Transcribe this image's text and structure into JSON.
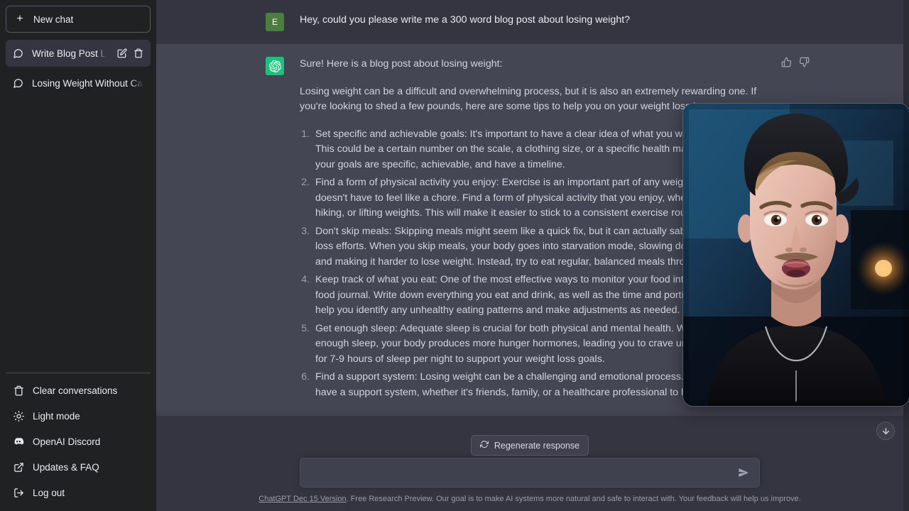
{
  "sidebar": {
    "new_chat_label": "New chat",
    "chats": [
      {
        "title": "Write Blog Post Losing",
        "active": true
      },
      {
        "title": "Losing Weight Without Calorie",
        "active": false
      }
    ],
    "bottom_items": [
      {
        "label": "Clear conversations",
        "icon": "trash-icon"
      },
      {
        "label": "Light mode",
        "icon": "sun-icon"
      },
      {
        "label": "OpenAI Discord",
        "icon": "discord-icon"
      },
      {
        "label": "Updates & FAQ",
        "icon": "external-link-icon"
      },
      {
        "label": "Log out",
        "icon": "logout-icon"
      }
    ]
  },
  "conversation": {
    "user": {
      "avatar_initial": "E",
      "text": "Hey, could you please write me a 300 word blog post about losing weight?"
    },
    "assistant": {
      "intro": "Sure! Here is a blog post about losing weight:",
      "paragraph": "Losing weight can be a difficult and overwhelming process, but it is also an extremely rewarding one. If you're looking to shed a few pounds, here are some tips to help you on your weight loss journey:",
      "list": [
        "Set specific and achievable goals: It's important to have a clear idea of what you want to accomplish. This could be a certain number on the scale, a clothing size, or a specific health marker. Make sure your goals are specific, achievable, and have a timeline.",
        "Find a form of physical activity you enjoy: Exercise is an important part of any weight loss journey, but it doesn't have to feel like a chore. Find a form of physical activity that you enjoy, whether it's dancing, hiking, or lifting weights. This will make it easier to stick to a consistent exercise routine.",
        "Don't skip meals: Skipping meals might seem like a quick fix, but it can actually sabotage your weight loss efforts. When you skip meals, your body goes into starvation mode, slowing down your metabolism and making it harder to lose weight. Instead, try to eat regular, balanced meals throughout the day.",
        "Keep track of what you eat: One of the most effective ways to monitor your food intake is by keeping a food journal. Write down everything you eat and drink, as well as the time and portion size. This will help you identify any unhealthy eating patterns and make adjustments as needed.",
        "Get enough sleep: Adequate sleep is crucial for both physical and mental health. When you don't get enough sleep, your body produces more hunger hormones, leading you to crave unhealthy foods. Aim for 7-9 hours of sleep per night to support your weight loss goals.",
        "Find a support system: Losing weight can be a challenging and emotional process. It's important to have a support system, whether it's friends, family, or a healthcare professional to help"
      ]
    }
  },
  "composer": {
    "placeholder": "",
    "value": "",
    "regenerate_label": "Regenerate response",
    "send_icon": "send-icon"
  },
  "footer": {
    "version_link": "ChatGPT Dec 15 Version",
    "note": ". Free Research Preview. Our goal is to make AI systems more natural and safe to interact with. Your feedback will help us improve."
  },
  "colors": {
    "sidebar_bg": "#202123",
    "main_bg": "#343541",
    "assistant_bg": "#444654",
    "accent_green": "#19c37d",
    "user_avatar_green": "#4b7f3f",
    "composer_bg": "#40414f",
    "text_primary": "#ececf1",
    "text_secondary": "#d1d5db",
    "text_muted": "#9b9ba5"
  }
}
